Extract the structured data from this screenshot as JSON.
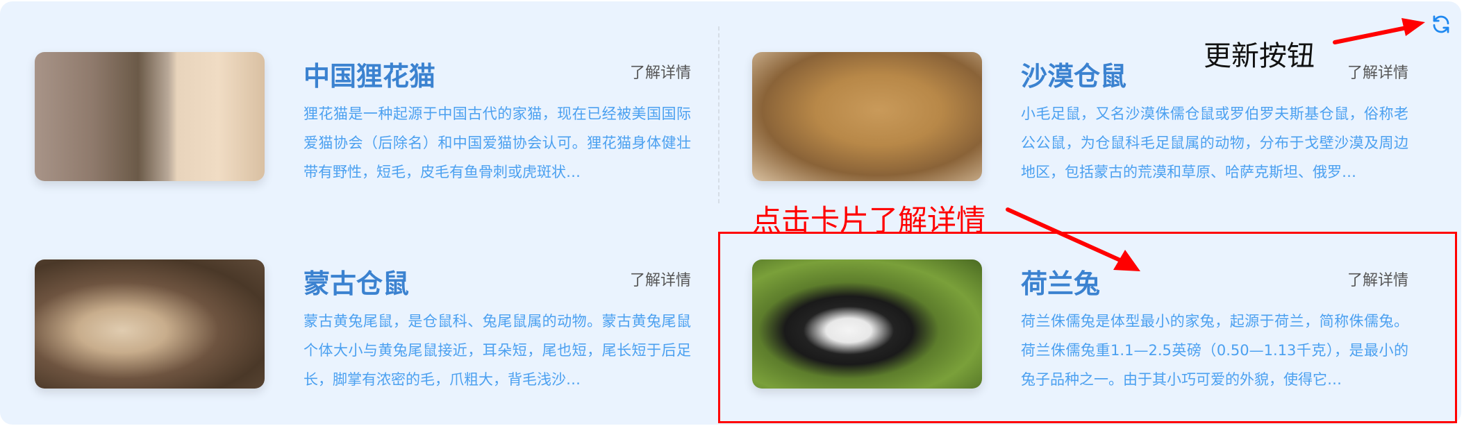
{
  "refresh_button": {
    "icon": "refresh-icon",
    "color": "#1e88f0"
  },
  "cards": [
    {
      "title": "中国狸花猫",
      "more": "了解详情",
      "desc": "狸花猫是一种起源于中国古代的家猫，现在已经被美国国际爱猫协会（后除名）和中国爱猫协会认可。狸花猫身体健壮带有野性，短毛，皮毛有鱼骨刺或虎斑状…"
    },
    {
      "title": "沙漠仓鼠",
      "more": "了解详情",
      "desc": "小毛足鼠，又名沙漠侏儒仓鼠或罗伯罗夫斯基仓鼠，俗称老公公鼠，为仓鼠科毛足鼠属的动物，分布于戈壁沙漠及周边地区，包括蒙古的荒漠和草原、哈萨克斯坦、俄罗…"
    },
    {
      "title": "蒙古仓鼠",
      "more": "了解详情",
      "desc": "蒙古黄兔尾鼠，是仓鼠科、兔尾鼠属的动物。蒙古黄兔尾鼠个体大小与黄兔尾鼠接近，耳朵短，尾也短，尾长短于后足长，脚掌有浓密的毛，爪粗大，背毛浅沙…"
    },
    {
      "title": "荷兰兔",
      "more": "了解详情",
      "desc": "荷兰侏儒兔是体型最小的家兔，起源于荷兰，简称侏儒兔。荷兰侏儒兔重1.1—2.5英磅（0.50—1.13千克），是最小的兔子品种之一。由于其小巧可爱的外貌，使得它…"
    }
  ],
  "annotations": {
    "refresh_label": "更新按钮",
    "card_label": "点击卡片了解详情",
    "color": "#ff0000"
  }
}
